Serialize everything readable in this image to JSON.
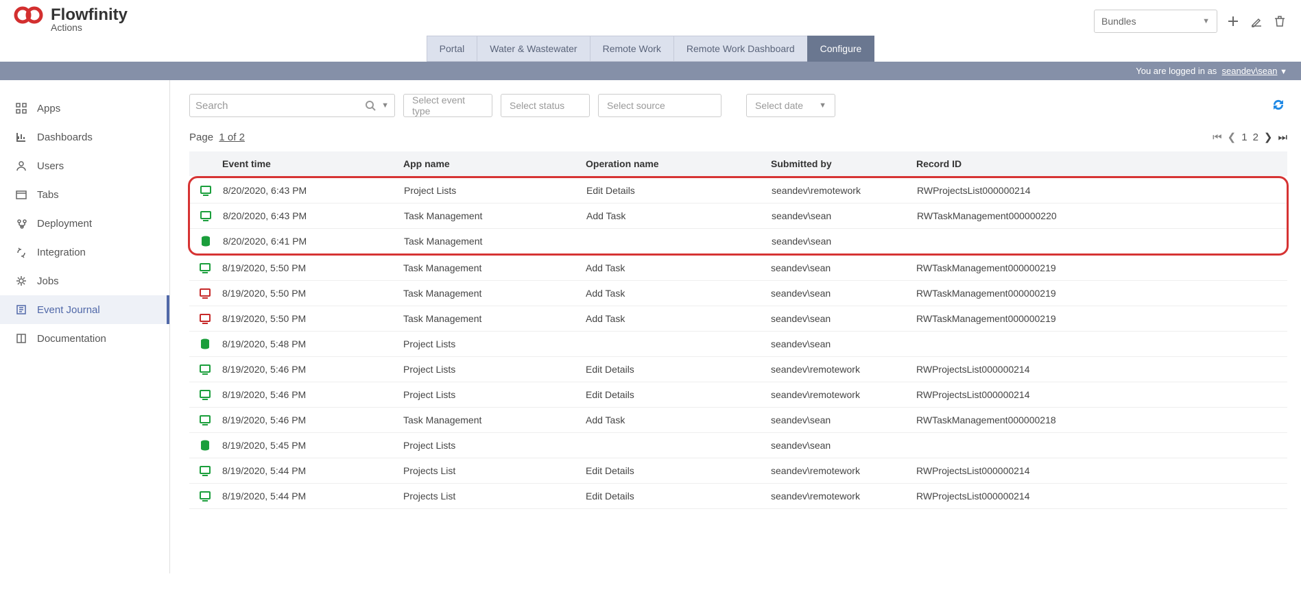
{
  "brand": {
    "name": "Flowfinity",
    "sub": "Actions"
  },
  "header": {
    "bundles_label": "Bundles",
    "login_prefix": "You are logged in as",
    "login_user": "seandev\\sean"
  },
  "tabs": [
    {
      "label": "Portal"
    },
    {
      "label": "Water & Wastewater"
    },
    {
      "label": "Remote Work"
    },
    {
      "label": "Remote Work Dashboard"
    },
    {
      "label": "Configure",
      "active": true
    }
  ],
  "sidebar": [
    {
      "label": "Apps",
      "icon": "grid"
    },
    {
      "label": "Dashboards",
      "icon": "chart"
    },
    {
      "label": "Users",
      "icon": "user"
    },
    {
      "label": "Tabs",
      "icon": "tabs"
    },
    {
      "label": "Deployment",
      "icon": "deploy"
    },
    {
      "label": "Integration",
      "icon": "integration"
    },
    {
      "label": "Jobs",
      "icon": "gear"
    },
    {
      "label": "Event Journal",
      "icon": "journal",
      "active": true
    },
    {
      "label": "Documentation",
      "icon": "book"
    }
  ],
  "filters": {
    "search_ph": "Search",
    "event_ph": "Select event type",
    "status_ph": "Select status",
    "source_ph": "Select source",
    "date_ph": "Select date"
  },
  "page": {
    "label": "Page",
    "info": "1 of 2",
    "nums": [
      "1",
      "2"
    ]
  },
  "columns": {
    "time": "Event time",
    "app": "App name",
    "op": "Operation name",
    "sub": "Submitted by",
    "rec": "Record ID"
  },
  "highlighted": [
    {
      "icon": "monitor",
      "iconColor": "#1a9e3b",
      "time": "8/20/2020, 6:43 PM",
      "app": "Project Lists",
      "op": "Edit Details",
      "sub": "seandev\\remotework",
      "rec": "RWProjectsList000000214"
    },
    {
      "icon": "monitor",
      "iconColor": "#1a9e3b",
      "time": "8/20/2020, 6:43 PM",
      "app": "Task Management",
      "op": "Add Task",
      "sub": "seandev\\sean",
      "rec": "RWTaskManagement000000220"
    },
    {
      "icon": "db",
      "iconColor": "#1a9e3b",
      "time": "8/20/2020, 6:41 PM",
      "app": "Task Management",
      "op": "",
      "sub": "seandev\\sean",
      "rec": ""
    }
  ],
  "rows": [
    {
      "icon": "monitor",
      "iconColor": "#1a9e3b",
      "time": "8/19/2020, 5:50 PM",
      "app": "Task Management",
      "op": "Add Task",
      "sub": "seandev\\sean",
      "rec": "RWTaskManagement000000219"
    },
    {
      "icon": "monitor",
      "iconColor": "#c62828",
      "time": "8/19/2020, 5:50 PM",
      "app": "Task Management",
      "op": "Add Task",
      "sub": "seandev\\sean",
      "rec": "RWTaskManagement000000219"
    },
    {
      "icon": "monitor",
      "iconColor": "#c62828",
      "time": "8/19/2020, 5:50 PM",
      "app": "Task Management",
      "op": "Add Task",
      "sub": "seandev\\sean",
      "rec": "RWTaskManagement000000219"
    },
    {
      "icon": "db",
      "iconColor": "#1a9e3b",
      "time": "8/19/2020, 5:48 PM",
      "app": "Project Lists",
      "op": "",
      "sub": "seandev\\sean",
      "rec": ""
    },
    {
      "icon": "monitor",
      "iconColor": "#1a9e3b",
      "time": "8/19/2020, 5:46 PM",
      "app": "Project Lists",
      "op": "Edit Details",
      "sub": "seandev\\remotework",
      "rec": "RWProjectsList000000214"
    },
    {
      "icon": "monitor",
      "iconColor": "#1a9e3b",
      "time": "8/19/2020, 5:46 PM",
      "app": "Project Lists",
      "op": "Edit Details",
      "sub": "seandev\\remotework",
      "rec": "RWProjectsList000000214"
    },
    {
      "icon": "monitor",
      "iconColor": "#1a9e3b",
      "time": "8/19/2020, 5:46 PM",
      "app": "Task Management",
      "op": "Add Task",
      "sub": "seandev\\sean",
      "rec": "RWTaskManagement000000218"
    },
    {
      "icon": "db",
      "iconColor": "#1a9e3b",
      "time": "8/19/2020, 5:45 PM",
      "app": "Project Lists",
      "op": "",
      "sub": "seandev\\sean",
      "rec": ""
    },
    {
      "icon": "monitor",
      "iconColor": "#1a9e3b",
      "time": "8/19/2020, 5:44 PM",
      "app": "Projects List",
      "op": "Edit Details",
      "sub": "seandev\\remotework",
      "rec": "RWProjectsList000000214"
    },
    {
      "icon": "monitor",
      "iconColor": "#1a9e3b",
      "time": "8/19/2020, 5:44 PM",
      "app": "Projects List",
      "op": "Edit Details",
      "sub": "seandev\\remotework",
      "rec": "RWProjectsList000000214"
    }
  ]
}
